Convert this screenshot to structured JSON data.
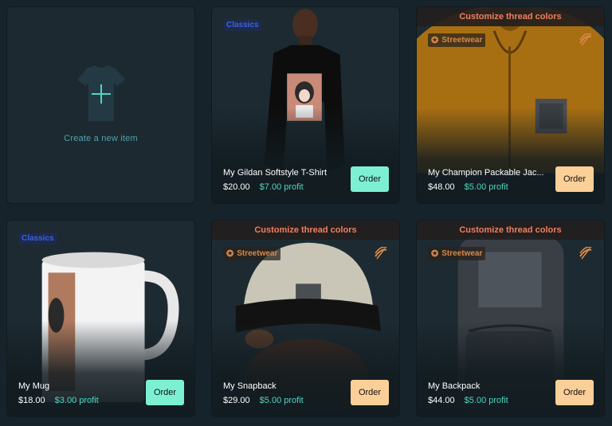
{
  "create": {
    "label": "Create a new item",
    "icon": "tshirt-plus-icon"
  },
  "banner_text": "Customize thread colors",
  "colors": {
    "background": "#17232a",
    "profit": "#4fd6c2",
    "order_mint": "#7df0d3",
    "order_peach": "#fbcf98",
    "banner": "#ef7f5f"
  },
  "products": [
    {
      "name": "My Gildan Softstyle T-Shirt",
      "price": "$20.00",
      "profit": "$7.00 profit",
      "collection": "Classics",
      "order_label": "Order"
    },
    {
      "name": "My Champion Packable Jac...",
      "price": "$48.00",
      "profit": "$5.00 profit",
      "collection": "Streetwear",
      "order_label": "Order"
    },
    {
      "name": "My Mug",
      "price": "$18.00",
      "profit": "$3.00 profit",
      "collection": "Classics",
      "order_label": "Order"
    },
    {
      "name": "My Snapback",
      "price": "$29.00",
      "profit": "$5.00 profit",
      "collection": "Streetwear",
      "order_label": "Order"
    },
    {
      "name": "My Backpack",
      "price": "$44.00",
      "profit": "$5.00 profit",
      "collection": "Streetwear",
      "order_label": "Order"
    }
  ]
}
